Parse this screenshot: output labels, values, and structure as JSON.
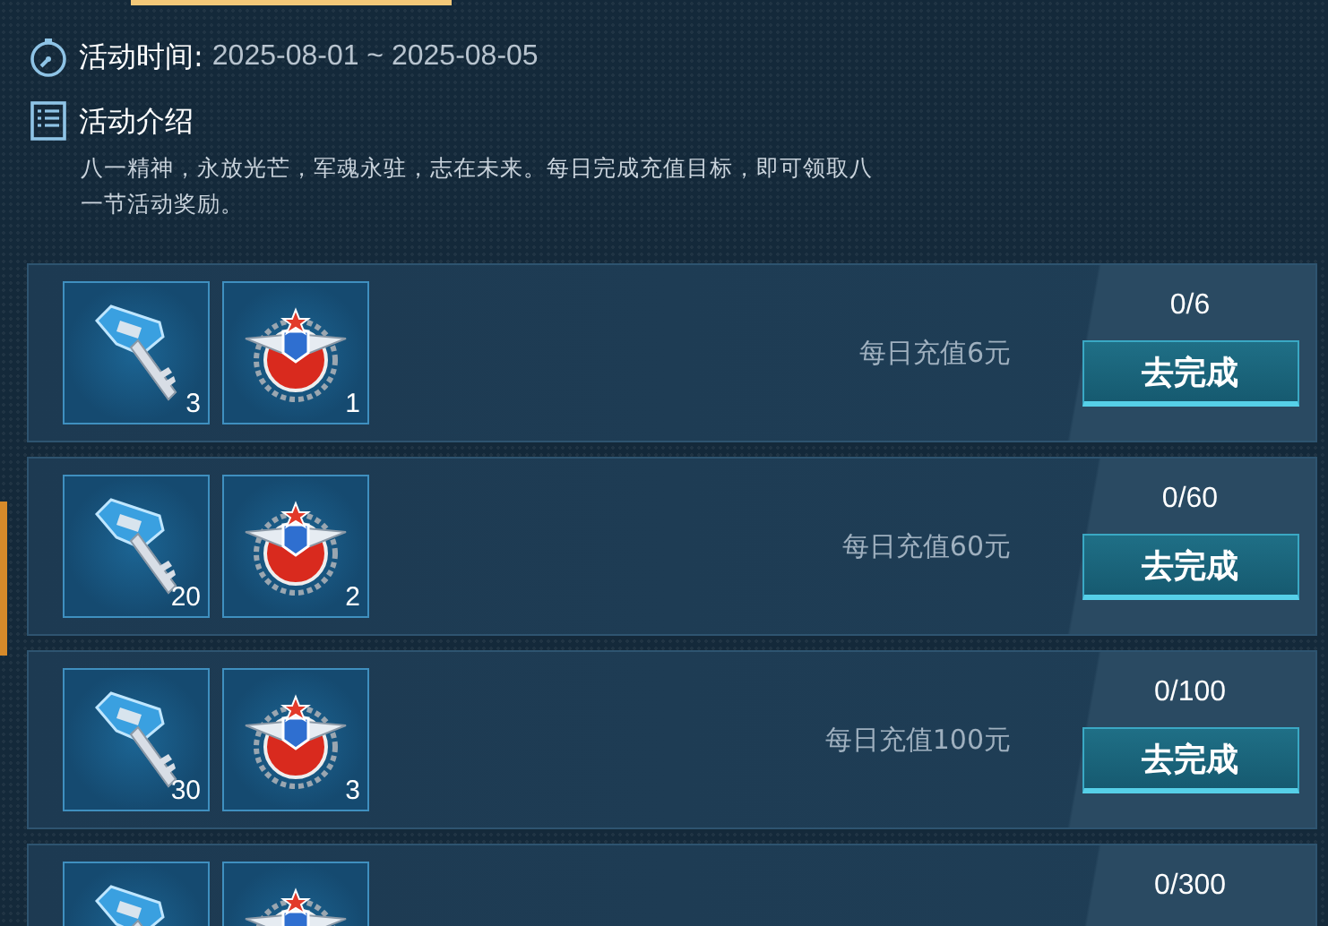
{
  "header": {
    "time_label": "活动时间:",
    "time_value": "2025-08-01 ~ 2025-08-05",
    "intro_title": "活动介绍",
    "intro_text": "八一精神，永放光芒，军魂永驻，志在未来。每日完成充值目标，即可领取八一节活动奖励。"
  },
  "tasks": [
    {
      "rewards": [
        {
          "kind": "key",
          "count": "3"
        },
        {
          "kind": "medal",
          "count": "1"
        }
      ],
      "goal": "每日充值6元",
      "progress": "0/6",
      "button": "去完成"
    },
    {
      "rewards": [
        {
          "kind": "key",
          "count": "20"
        },
        {
          "kind": "medal",
          "count": "2"
        }
      ],
      "goal": "每日充值60元",
      "progress": "0/60",
      "button": "去完成"
    },
    {
      "rewards": [
        {
          "kind": "key",
          "count": "30"
        },
        {
          "kind": "medal",
          "count": "3"
        }
      ],
      "goal": "每日充值100元",
      "progress": "0/100",
      "button": "去完成"
    },
    {
      "rewards": [
        {
          "kind": "key"
        },
        {
          "kind": "medal"
        }
      ],
      "progress": "0/300"
    }
  ]
}
